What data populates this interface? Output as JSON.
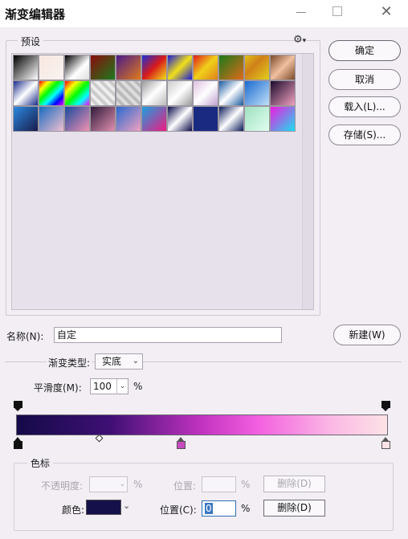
{
  "window": {
    "title": "渐变编辑器"
  },
  "presets": {
    "label": "预设",
    "swatches": [
      "linear-gradient(135deg,#000 0%,#fff 100%)",
      "linear-gradient(135deg,#f7e7e0 0%,#f9f3f0 100%)",
      "linear-gradient(135deg,#000 0%,#fff 60%,#ddd 100%)",
      "linear-gradient(135deg,#8a0d0d 0%,#1c7a1c 100%)",
      "linear-gradient(135deg,#4a1a8a 0%,#e07b1a 100%)",
      "linear-gradient(135deg,#1a2fd8 0%,#d81a1a 50%,#f0e01a 100%)",
      "linear-gradient(135deg,#1a1ad8 0%,#f0e01a 50%,#1a1ad8 100%)",
      "linear-gradient(135deg,#e01a1a 0%,#f0d01a 50%,#e0801a 100%)",
      "linear-gradient(135deg,#1a7a1a 0%,#e06a1a 100%)",
      "linear-gradient(135deg,#e0c01a 0%,#d0801a 40%,#e0d01a 100%)",
      "linear-gradient(135deg,#7a4a2a 0%,#f0c0a0 50%,#7a4a2a 100%)",
      "linear-gradient(135deg,#1a2a8a 0%,#fff 50%,#1a2a8a 100%)",
      "linear-gradient(135deg,#f00 0%,#ff0 20%,#0f0 40%,#0ff 60%,#00f 80%,#f0f 100%)",
      "linear-gradient(135deg,#f00 0%,#ff0 25%,#0f0 50%,#0ff 75%,#f0f 100%)",
      "repeating-linear-gradient(45deg,#eee 0 4px,#ccc 4px 8px)",
      "repeating-linear-gradient(45deg,#ddd 0 4px,#bbb 4px 8px)",
      "linear-gradient(135deg,#999 0%,#fff 50%,#bbb 100%)",
      "linear-gradient(135deg,#ccc 0%,#fff 50%,#999 100%)",
      "linear-gradient(135deg,#e0c0e0 0%,#fff 50%,#c0a0d0 100%)",
      "linear-gradient(135deg,#1a5aa0 0%,#fff 50%,#1a5aa0 100%)",
      "linear-gradient(135deg,#1a6ad0 0%,#c0e0f8 100%)",
      "linear-gradient(135deg,#1a0a2a 0%,#f0a0c0 100%)",
      "linear-gradient(135deg,#2a8ae0 0%,#1a1a4a 100%)",
      "linear-gradient(135deg,#1a6ac0 0%,#f0c0d0 100%)",
      "linear-gradient(135deg,#1a4aa0 0%,#f090b0 100%)",
      "linear-gradient(135deg,#301a3a 0%,#e090b0 100%)",
      "linear-gradient(135deg,#2a6ad0 0%,#f0a0c0 100%)",
      "linear-gradient(135deg,#1aa0e0 0%,#f01a80 100%)",
      "linear-gradient(135deg,#0a0a4a 0%,#fff 50%,#0a0a4a 100%)",
      "linear-gradient(135deg,#1a2a80 0%,#1a2a80 100%)",
      "linear-gradient(135deg,#0a1a5a 0%,#fff 50%,#0a1a5a 100%)",
      "linear-gradient(135deg,#a0e0c0 0%,#e0fff0 100%)",
      "linear-gradient(135deg,#f01ae0 0%,#1ae0f0 100%)"
    ]
  },
  "buttons": {
    "ok": "确定",
    "cancel": "取消",
    "load": "载入(L)...",
    "save": "存储(S)...",
    "new": "新建(W)"
  },
  "name": {
    "label": "名称(N):",
    "value": "自定"
  },
  "gradient_type": {
    "label": "渐变类型:",
    "value": "实底"
  },
  "smoothness": {
    "label": "平滑度(M):",
    "value": "100",
    "unit": "%"
  },
  "gradient_bar": {
    "css": "linear-gradient(to right,#140a48 0%,#3e0f74 25%,#c233c0 50%,#f35fe0 65%,#fbb8e4 85%,#fde2e6 100%)"
  },
  "color_stops": {
    "label": "色标",
    "opacity_label": "不透明度:",
    "opacity_value": "",
    "opacity_unit": "%",
    "opacity_pos_label": "位置:",
    "opacity_pos_value": "",
    "opacity_pos_unit": "%",
    "opacity_delete": "删除(D)",
    "color_label": "颜色:",
    "color_value": "#15104a",
    "color_pos_label": "位置(C):",
    "color_pos_value": "0",
    "color_pos_unit": "%",
    "color_delete": "删除(D)"
  }
}
